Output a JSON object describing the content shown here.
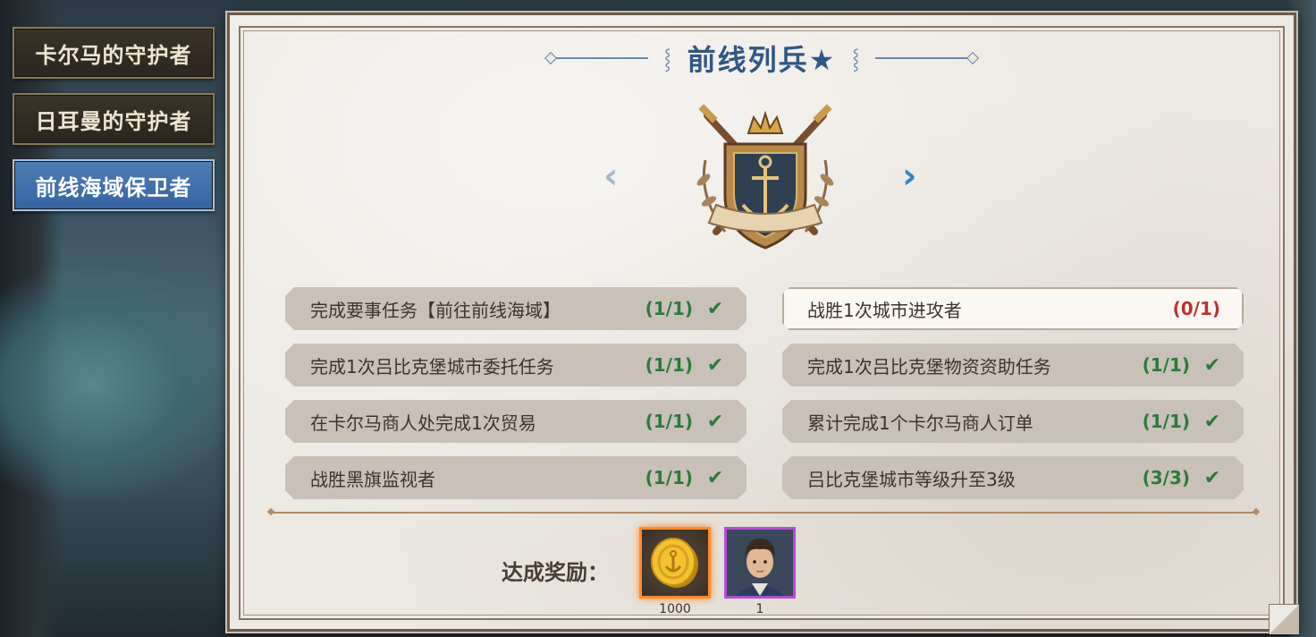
{
  "side_tabs": [
    {
      "label": "卡尔马的守护者",
      "active": false
    },
    {
      "label": "日耳曼的守护者",
      "active": false
    },
    {
      "label": "前线海域保卫者",
      "active": true
    }
  ],
  "panel": {
    "title": "前线列兵★"
  },
  "tasks": {
    "left": [
      {
        "label": "完成要事任务【前往前线海域】",
        "progress": "(1/1)",
        "check": "✔"
      },
      {
        "label": "完成1次吕比克堡城市委托任务",
        "progress": "(1/1)",
        "check": "✔"
      },
      {
        "label": "在卡尔马商人处完成1次贸易",
        "progress": "(1/1)",
        "check": "✔"
      },
      {
        "label": "战胜黑旗监视者",
        "progress": "(1/1)",
        "check": "✔"
      }
    ],
    "right": [
      {
        "label": "战胜1次城市进攻者",
        "progress": "(0/1)",
        "check": ""
      },
      {
        "label": "完成1次吕比克堡物资资助任务",
        "progress": "(1/1)",
        "check": "✔"
      },
      {
        "label": "累计完成1个卡尔马商人订单",
        "progress": "(1/1)",
        "check": "✔"
      },
      {
        "label": "吕比克堡城市等级升至3级",
        "progress": "(3/3)",
        "check": "✔"
      }
    ]
  },
  "rewards": {
    "label": "达成奖励：",
    "items": [
      {
        "icon": "gold-coin-icon",
        "count": "1000"
      },
      {
        "icon": "captain-portrait-icon",
        "count": "1"
      }
    ]
  },
  "nav": {
    "prev": "‹",
    "next": "›"
  },
  "colors": {
    "accent_blue": "#2f5784",
    "complete_green": "#2c7a3a",
    "incomplete_red": "#b8342b",
    "gold_frame": "#ff8a2a",
    "purple_frame": "#b64ad6"
  }
}
